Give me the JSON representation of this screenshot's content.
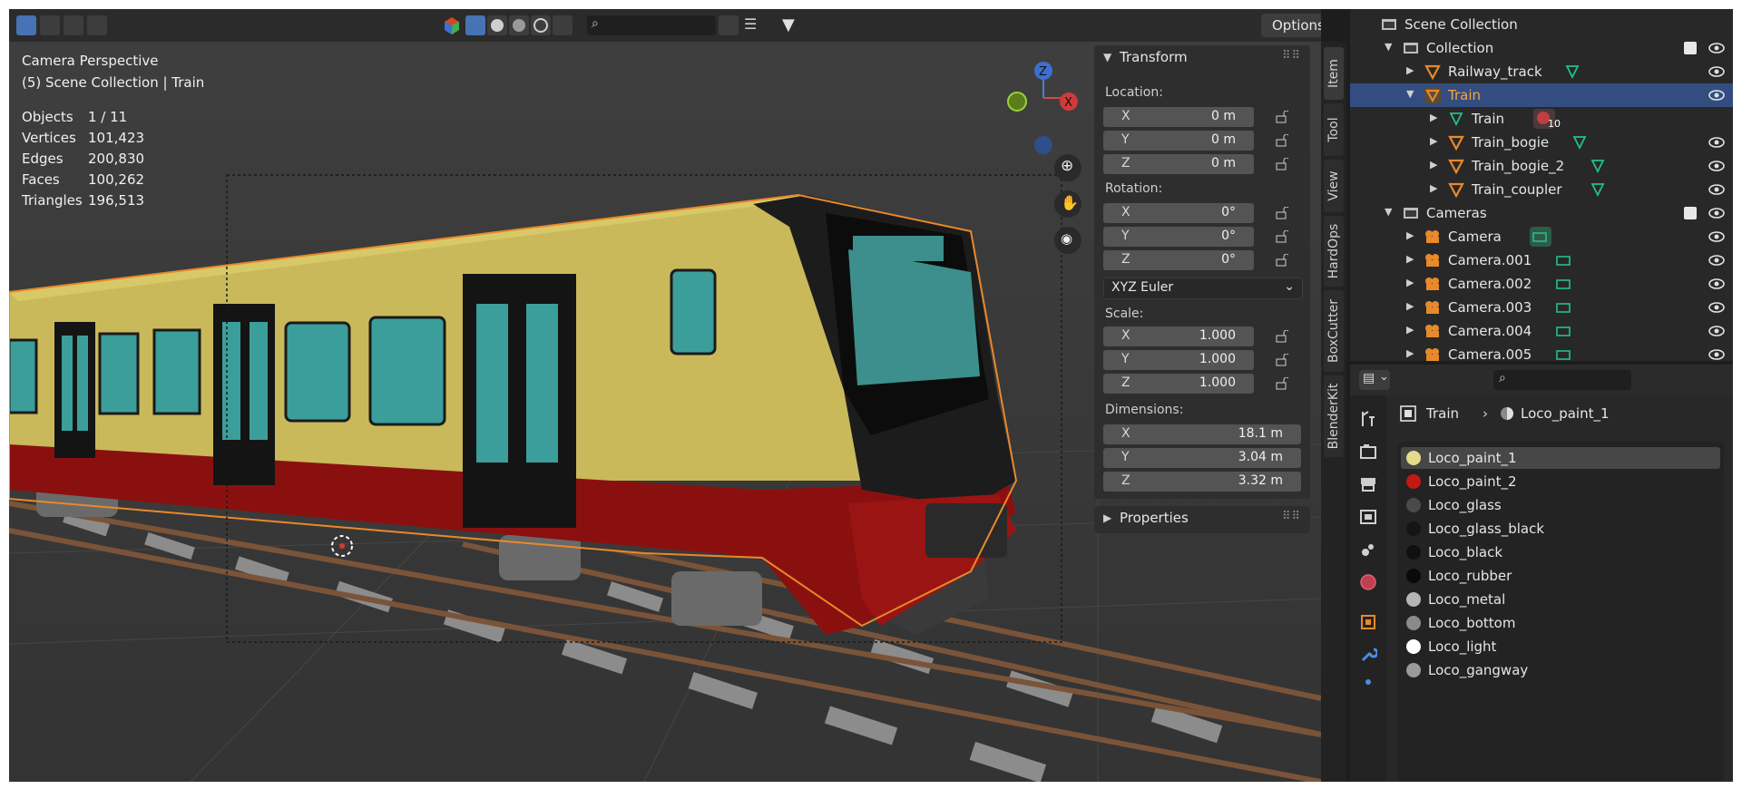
{
  "viewport": {
    "search_placeholder": "",
    "options_label": "Options",
    "overlay": {
      "view_name": "Camera Perspective",
      "context": "(5) Scene Collection | Train"
    },
    "stats": [
      {
        "key": "Objects",
        "value": "1 / 11"
      },
      {
        "key": "Vertices",
        "value": "101,423"
      },
      {
        "key": "Edges",
        "value": "200,830"
      },
      {
        "key": "Faces",
        "value": "100,262"
      },
      {
        "key": "Triangles",
        "value": "196,513"
      }
    ],
    "gizmo": {
      "z": "Z",
      "x": "X"
    }
  },
  "npanel": {
    "transform_title": "Transform",
    "location_label": "Location:",
    "location": [
      {
        "axis": "X",
        "value": "0 m"
      },
      {
        "axis": "Y",
        "value": "0 m"
      },
      {
        "axis": "Z",
        "value": "0 m"
      }
    ],
    "rotation_label": "Rotation:",
    "rotation": [
      {
        "axis": "X",
        "value": "0°"
      },
      {
        "axis": "Y",
        "value": "0°"
      },
      {
        "axis": "Z",
        "value": "0°"
      }
    ],
    "rotation_mode": "XYZ Euler",
    "scale_label": "Scale:",
    "scale": [
      {
        "axis": "X",
        "value": "1.000"
      },
      {
        "axis": "Y",
        "value": "1.000"
      },
      {
        "axis": "Z",
        "value": "1.000"
      }
    ],
    "dimensions_label": "Dimensions:",
    "dimensions": [
      {
        "axis": "X",
        "value": "18.1 m"
      },
      {
        "axis": "Y",
        "value": "3.04 m"
      },
      {
        "axis": "Z",
        "value": "3.32 m"
      }
    ],
    "properties_title": "Properties"
  },
  "side_tabs": [
    "Item",
    "Tool",
    "View",
    "HardOps",
    "BoxCutter",
    "BlenderKit"
  ],
  "outliner": {
    "rows": [
      {
        "label": "Scene Collection"
      },
      {
        "label": "Collection"
      },
      {
        "label": "Railway_track"
      },
      {
        "label": "Train"
      },
      {
        "label": "Train",
        "badge": "10"
      },
      {
        "label": "Train_bogie"
      },
      {
        "label": "Train_bogie_2"
      },
      {
        "label": "Train_coupler"
      },
      {
        "label": "Cameras"
      },
      {
        "label": "Camera"
      },
      {
        "label": "Camera.001"
      },
      {
        "label": "Camera.002"
      },
      {
        "label": "Camera.003"
      },
      {
        "label": "Camera.004"
      },
      {
        "label": "Camera.005"
      }
    ]
  },
  "properties": {
    "breadcrumb_object": "Train",
    "breadcrumb_material": "Loco_paint_1",
    "materials": [
      {
        "name": "Loco_paint_1",
        "color": "#e3dc8a"
      },
      {
        "name": "Loco_paint_2",
        "color": "#c01a12"
      },
      {
        "name": "Loco_glass",
        "color": "#4a4a4a"
      },
      {
        "name": "Loco_glass_black",
        "color": "#151515"
      },
      {
        "name": "Loco_black",
        "color": "#101010"
      },
      {
        "name": "Loco_rubber",
        "color": "#0a0a0a"
      },
      {
        "name": "Loco_metal",
        "color": "#b5b5b5"
      },
      {
        "name": "Loco_bottom",
        "color": "#8a8a8a"
      },
      {
        "name": "Loco_light",
        "color": "#ffffff"
      },
      {
        "name": "Loco_gangway",
        "color": "#9a9a9a"
      }
    ]
  },
  "colors": {
    "selection": "#334d80",
    "accent_orange": "#e8892a",
    "mesh_green": "#22c08a",
    "train_yellow": "#c9b95a",
    "train_red": "#8a1010"
  }
}
